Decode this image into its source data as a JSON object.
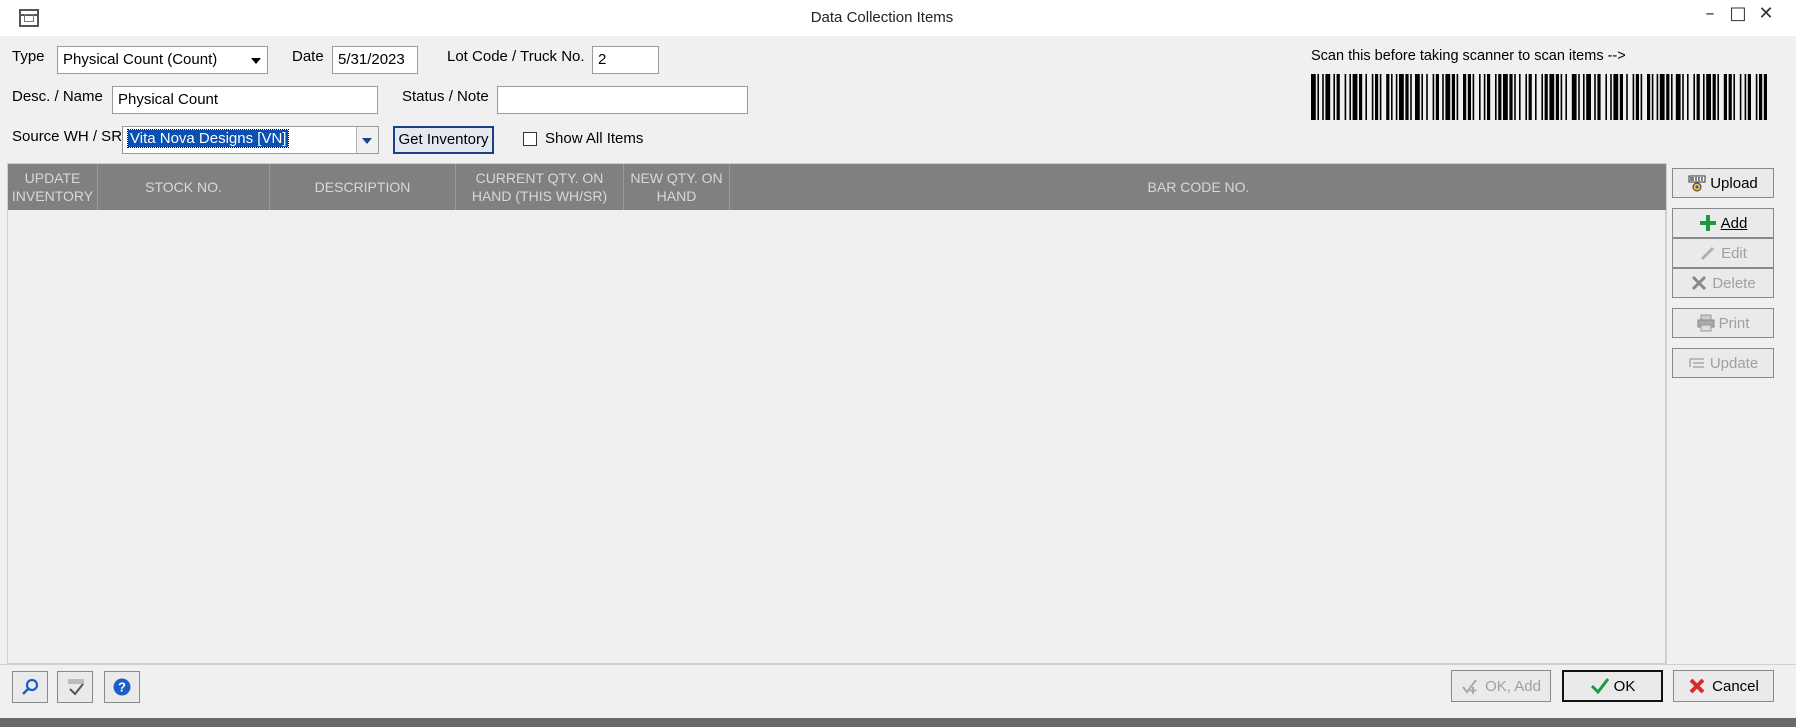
{
  "window": {
    "title": "Data Collection Items",
    "minimize_glyph": "–",
    "maximize_glyph": "□",
    "close_glyph": "✕"
  },
  "form": {
    "type_label": "Type",
    "type_value": "Physical Count (Count)",
    "date_label": "Date",
    "date_value": "5/31/2023",
    "lot_label": "Lot Code / Truck No.",
    "lot_value": "2",
    "desc_label": "Desc. / Name",
    "desc_value": "Physical Count",
    "status_label": "Status / Note",
    "status_value": "",
    "source_label": "Source WH / SR",
    "source_value": "Vita Nova Designs [VN]",
    "get_inventory_label": "Get Inventory",
    "show_all_label": "Show All Items",
    "show_all_checked": false,
    "scan_prompt": "Scan this before taking scanner to scan items -->"
  },
  "grid": {
    "columns": [
      "UPDATE INVENTORY",
      "STOCK NO.",
      "DESCRIPTION",
      "CURRENT QTY. ON HAND (THIS WH/SR)",
      "NEW QTY. ON HAND",
      "BAR CODE NO."
    ],
    "rows": []
  },
  "side_buttons": {
    "upload": "Upload",
    "add": "Add",
    "edit": "Edit",
    "delete": "Delete",
    "print": "Print",
    "update": "Update"
  },
  "footer": {
    "ok_add": "OK, Add",
    "ok": "OK",
    "cancel": "Cancel"
  },
  "colors": {
    "header_bg": "#808080",
    "selection": "#0a4fb2",
    "add_green": "#1f9a3a",
    "cancel_red": "#d82b2b",
    "help_blue": "#1a5fc8"
  }
}
